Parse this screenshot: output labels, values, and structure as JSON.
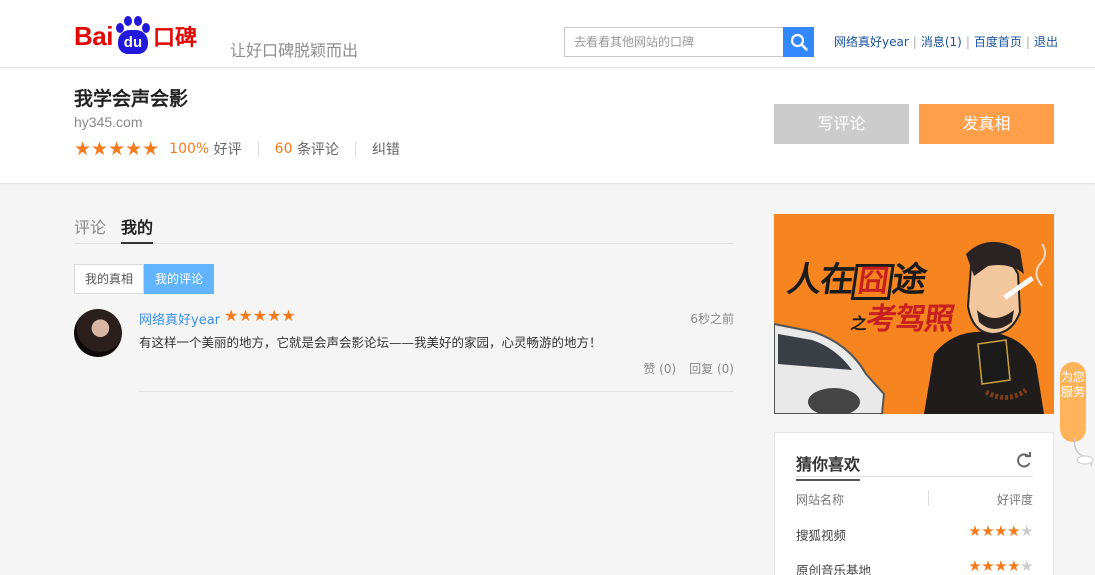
{
  "header": {
    "logo": {
      "bai": "Bai",
      "du": "du",
      "koubei": "口碑"
    },
    "slogan": "让好口碑脱颖而出",
    "search": {
      "placeholder": "去看看其他网站的口碑"
    },
    "user_links": {
      "username": "网络真好year",
      "messages": "消息(1)",
      "home": "百度首页",
      "logout": "退出"
    }
  },
  "site": {
    "title": "我学会声会影",
    "domain": "hy345.com",
    "stars_display": "★★★★★",
    "good_rate_value": "100%",
    "good_rate_label": "好评",
    "review_count": "60",
    "review_count_label": "条评论",
    "correction": "纠错",
    "write_review_button": "写评论",
    "post_truth_button": "发真相"
  },
  "tabs": {
    "reviews": "评论",
    "mine": "我的"
  },
  "subtabs": {
    "my_truths": "我的真相",
    "my_reviews": "我的评论"
  },
  "review": {
    "username": "网络真好year",
    "stars_display": "★★★★★",
    "time": "6秒之前",
    "text": "有这样一个美丽的地方，它就是会声会影论坛——我美好的家园，心灵畅游的地方！",
    "like": "赞 (0)",
    "reply": "回复 (0)"
  },
  "ad": {
    "line1": "人在",
    "line1_box": "囧",
    "line1_end": "途",
    "line2_small": "之",
    "line2": "考驾照"
  },
  "guess": {
    "title": "猜你喜欢",
    "col_name": "网站名称",
    "col_rating": "好评度",
    "rows": [
      {
        "name": "搜狐视频",
        "stars_filled": "★★★★",
        "stars_empty": "★",
        "rating": 4
      },
      {
        "name": "原创音乐基地",
        "stars_filled": "★★★★",
        "stars_empty": "★",
        "rating": 4.5
      }
    ]
  },
  "service_badge": "为您服务",
  "colors": {
    "accent_orange": "#f77b1c",
    "primary_blue": "#3388ff",
    "link_blue": "#1a53a0",
    "baidu_red": "#e10602",
    "baidu_blue": "#2319dc"
  }
}
